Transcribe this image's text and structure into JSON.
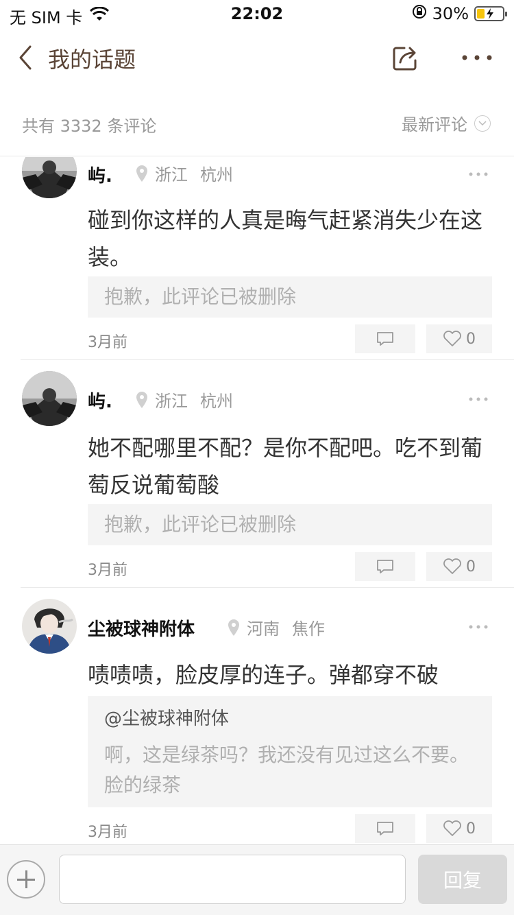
{
  "status_bar": {
    "carrier": "无 SIM 卡",
    "time": "22:02",
    "battery_percent": "30%",
    "battery_level": 0.3,
    "icons": [
      "wifi-icon",
      "orientation-lock-icon",
      "battery-charging-icon"
    ]
  },
  "nav": {
    "title": "我的话题",
    "icons": [
      "back-icon",
      "share-icon",
      "more-icon"
    ]
  },
  "subheader": {
    "count_text": "共有 3332 条评论",
    "sort_label": "最新评论"
  },
  "comments": [
    {
      "username": "屿.",
      "province": "浙江",
      "city": "杭州",
      "text": "碰到你这样的人真是晦气赶紧消失少在这装。",
      "quote_deleted": "抱歉，此评论已被删除",
      "time": "3月前",
      "likes": "0"
    },
    {
      "username": "屿.",
      "province": "浙江",
      "city": "杭州",
      "text": "她不配哪里不配？是你不配吧。吃不到葡萄反说葡萄酸",
      "quote_deleted": "抱歉，此评论已被删除",
      "time": "3月前",
      "likes": "0"
    },
    {
      "username": "尘被球神附体",
      "province": "河南",
      "city": "焦作",
      "text": "啧啧啧，脸皮厚的连子。弹都穿不破",
      "quote_author": "@尘被球神附体",
      "quote_text": "啊，这是绿茶吗？我还没有见过这么不要。脸的绿茶",
      "time": "3月前",
      "likes": "0"
    }
  ],
  "bottom_bar": {
    "input_value": "",
    "send_label": "回复"
  },
  "colors": {
    "title_brown": "#5a4436",
    "muted_gray": "#999999",
    "quote_bg": "#f4f4f4",
    "battery_yellow": "#f6c40a"
  }
}
